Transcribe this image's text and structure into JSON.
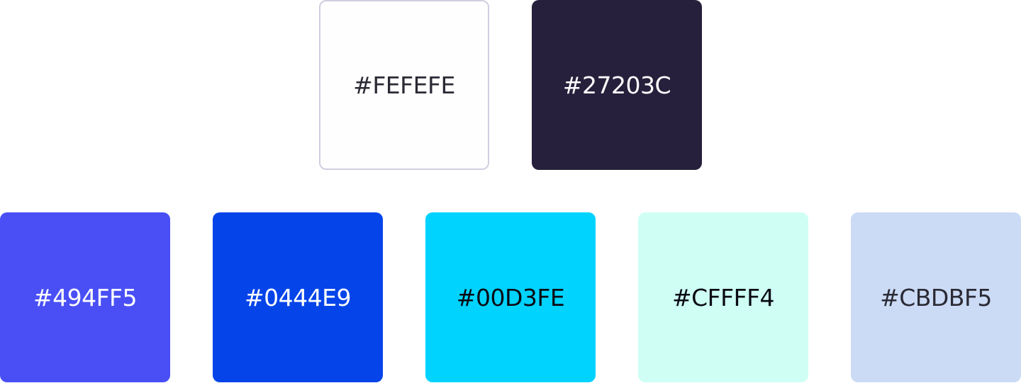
{
  "palette": {
    "primary": [
      {
        "label": "#FEFEFE",
        "color": "#FEFEFE",
        "text_color": "#2a2a35"
      },
      {
        "label": "#27203C",
        "color": "#27203C",
        "text_color": "#ffffff"
      }
    ],
    "secondary": [
      {
        "label": "#494FF5",
        "color": "#494FF5",
        "text_color": "#ffffff"
      },
      {
        "label": "#0444E9",
        "color": "#0444E9",
        "text_color": "#ffffff"
      },
      {
        "label": "#00D3FE",
        "color": "#00D3FE",
        "text_color": "#0a0a14"
      },
      {
        "label": "#CFFFF4",
        "color": "#CFFFF4",
        "text_color": "#0a0a14"
      },
      {
        "label": "#CBDBF5",
        "color": "#CBDBF5",
        "text_color": "#2a2a35"
      }
    ]
  }
}
